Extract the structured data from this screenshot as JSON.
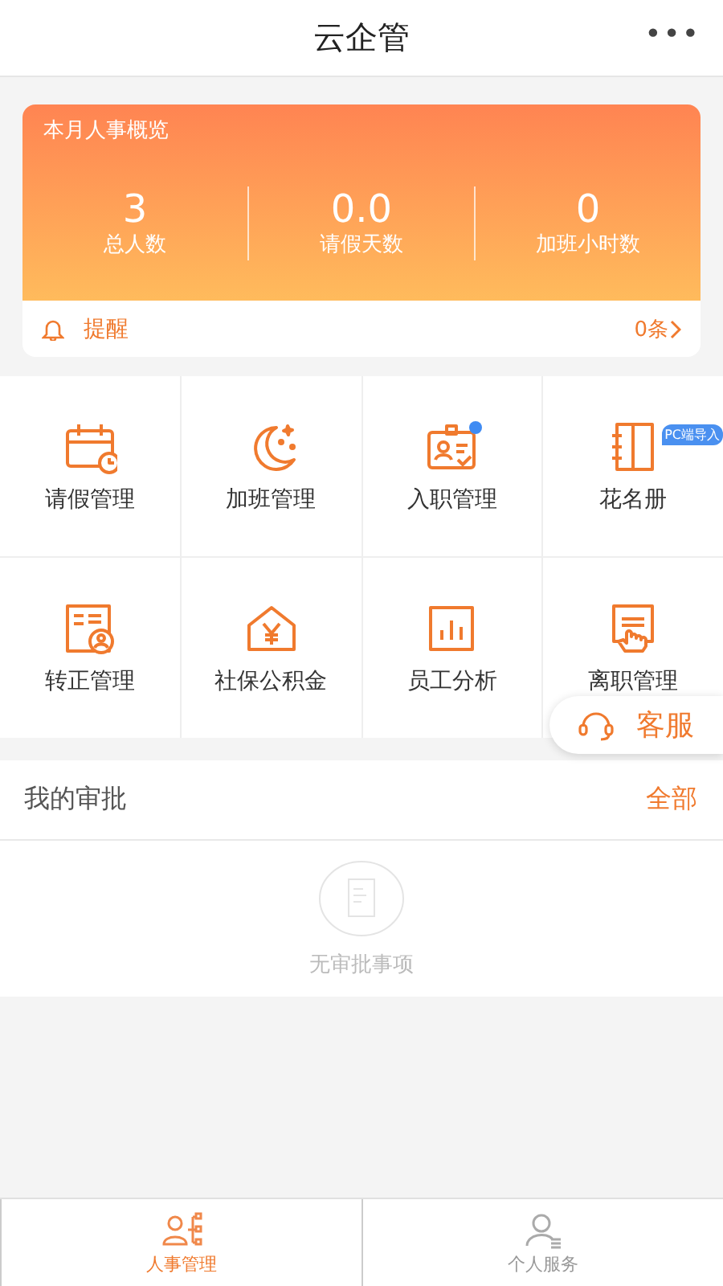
{
  "header": {
    "title": "云企管",
    "menu": "•••"
  },
  "overview": {
    "title": "本月人事概览",
    "stats": [
      {
        "value": "3",
        "label": "总人数"
      },
      {
        "value": "0.0",
        "label": "请假天数"
      },
      {
        "value": "0",
        "label": "加班小时数"
      }
    ],
    "reminder": {
      "label": "提醒",
      "count": "0条"
    }
  },
  "features": [
    {
      "kind": "calendar",
      "label": "请假管理"
    },
    {
      "kind": "moon",
      "label": "加班管理"
    },
    {
      "kind": "badge-card",
      "label": "入职管理",
      "dot": true
    },
    {
      "kind": "book",
      "label": "花名册",
      "tag": "PC端导入"
    },
    {
      "kind": "certificate",
      "label": "转正管理"
    },
    {
      "kind": "house",
      "label": "社保公积金"
    },
    {
      "kind": "chart",
      "label": "员工分析"
    },
    {
      "kind": "hand",
      "label": "离职管理"
    }
  ],
  "support": {
    "label": "客服"
  },
  "approvals": {
    "title": "我的审批",
    "link": "全部",
    "empty": "无审批事项"
  },
  "tabs": [
    {
      "label": "人事管理",
      "kind": "people",
      "selected": true
    },
    {
      "label": "个人服务",
      "kind": "person",
      "selected": false
    }
  ]
}
